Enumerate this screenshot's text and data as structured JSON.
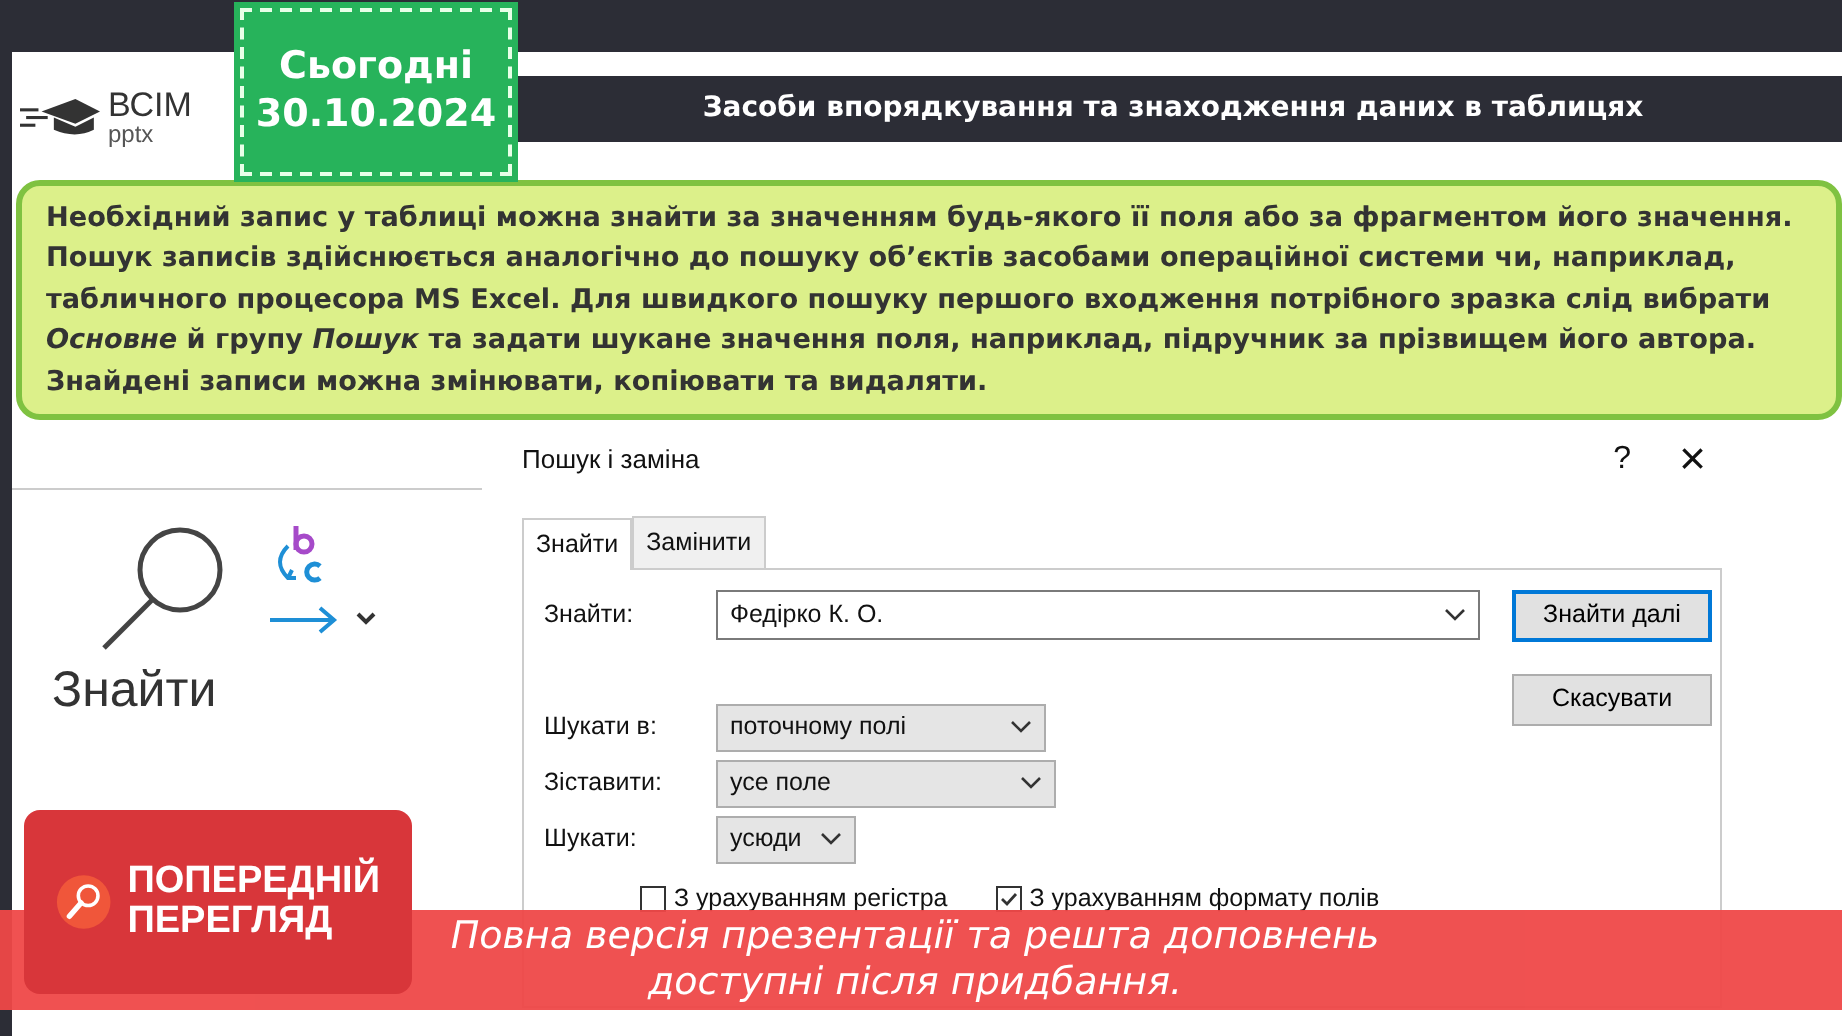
{
  "logo": {
    "name": "ВСІМ",
    "sub": "pptx"
  },
  "date_badge": {
    "label": "Сьогодні",
    "date": "30.10.2024"
  },
  "title": "Засоби впорядкування та знаходження даних в таблицях",
  "info_box": {
    "paragraphs": [
      "Необхідний запис у таблиці можна знайти за значенням будь-якого її поля або за фрагментом його значення. Пошук записів здійснюється аналогічно до пошуку об’єктів засобами операційної системи чи, наприклад, табличного процесора MS Excel. Для швидкого пошуку першого входження потрібного зразка слід вибрати *Основне* й групу *Пошук* та задати шукане значення поля, наприклад, підручник за прізвищем його автора.",
      "Знайдені записи можна змінювати, копіювати та видаляти."
    ]
  },
  "ribbon": {
    "find_label": "Знайти"
  },
  "dialog": {
    "title": "Пошук і заміна",
    "help": "?",
    "close": "×",
    "tabs": [
      {
        "label": "Знайти",
        "selected": true
      },
      {
        "label": "Замінити",
        "selected": false
      }
    ],
    "find": {
      "label": "Знайти:",
      "value": "Федірко К. О."
    },
    "buttons": [
      {
        "label": "Знайти далі",
        "default": true
      },
      {
        "label": "Скасувати",
        "default": false
      }
    ],
    "options": [
      {
        "label": "Шукати в:",
        "value": "поточному полі"
      },
      {
        "label": "Зіставити:",
        "value": "усе поле"
      },
      {
        "label": "Шукати:",
        "value": "усюди"
      }
    ],
    "checkboxes": [
      {
        "label": "З урахуванням регістра",
        "checked": false
      },
      {
        "label": "З урахуванням формату полів",
        "checked": true
      }
    ]
  },
  "preview_badge": {
    "line1": "ПОПЕРЕДНІЙ",
    "line2": "ПЕРЕГЛЯД"
  },
  "banner": {
    "line1": "Повна версія презентації та решта доповнень",
    "line2": "доступні після придбання."
  }
}
